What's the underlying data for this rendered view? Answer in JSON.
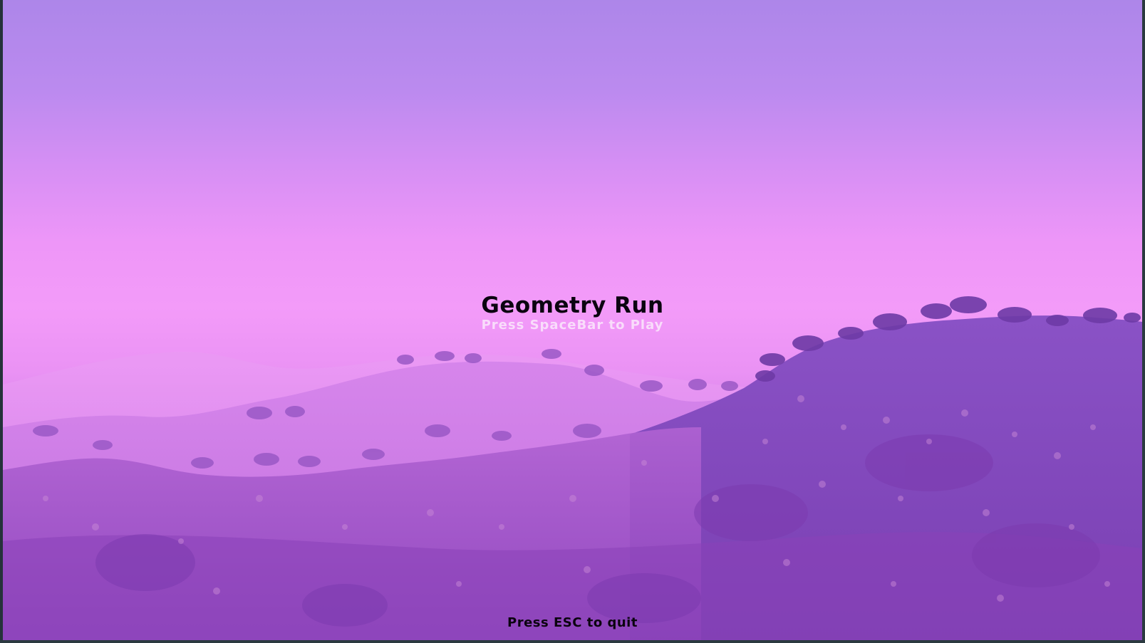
{
  "game": {
    "title": "Geometry Run",
    "play_prompt": "Press SpaceBar to Play",
    "quit_prompt": "Press ESC to quit"
  },
  "scene": {
    "description_icon": "misty-purple-hills-landscape",
    "sky_colors": [
      "#ad86e9",
      "#f39bf9"
    ],
    "hill_colors": [
      "#e79bf3",
      "#d27ee6",
      "#b866d6",
      "#9a50c4",
      "#7e3fb0"
    ],
    "title_color": "#0b0410",
    "prompt_color": "#f9dcfb"
  }
}
